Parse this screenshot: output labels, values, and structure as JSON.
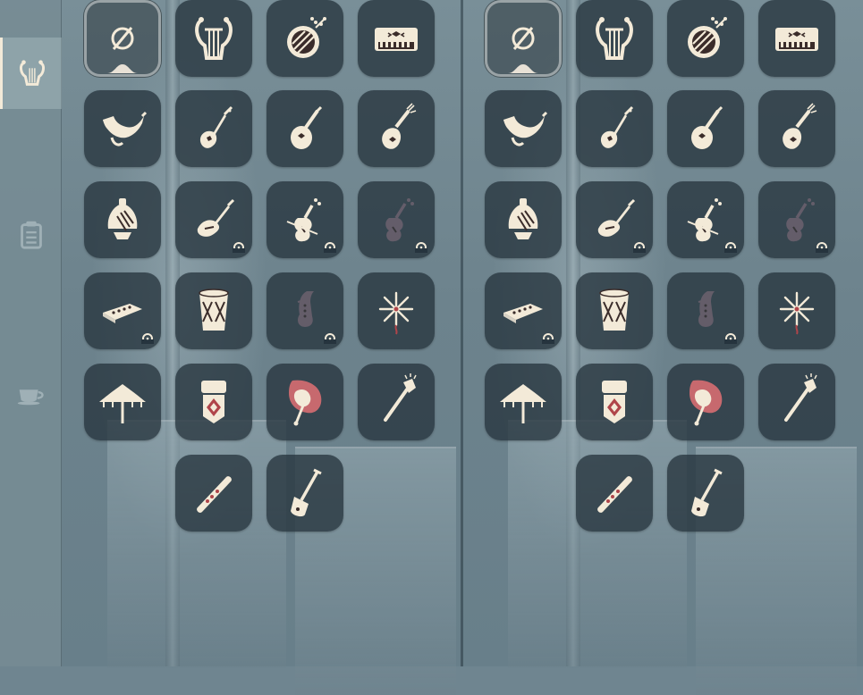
{
  "colors": {
    "icon_cream": "#f3ead8",
    "icon_dark": "#3a2c2a",
    "accent_red": "#b0454a",
    "slot_bg": "#26343e",
    "locked_icon": "#8a7080"
  },
  "sidebar": {
    "tabs": [
      {
        "icon": "lyre-icon",
        "active": true
      },
      {
        "icon": "clipboard-icon",
        "active": false
      },
      {
        "icon": "teacup-icon",
        "active": false
      }
    ]
  },
  "panels": [
    {
      "name": "left",
      "slots": [
        {
          "icon": "none-icon",
          "selected": true,
          "locked": false,
          "badge": false
        },
        {
          "icon": "lyre-icon",
          "selected": false,
          "locked": false,
          "badge": false
        },
        {
          "icon": "drum-icon",
          "selected": false,
          "locked": false,
          "badge": false
        },
        {
          "icon": "piano-icon",
          "selected": false,
          "locked": false,
          "badge": false
        },
        {
          "icon": "horn-icon",
          "selected": false,
          "locked": false,
          "badge": false
        },
        {
          "icon": "guitar-icon",
          "selected": false,
          "locked": false,
          "badge": false
        },
        {
          "icon": "mandolin-icon",
          "selected": false,
          "locked": false,
          "badge": false
        },
        {
          "icon": "pipa-icon",
          "selected": false,
          "locked": false,
          "badge": false
        },
        {
          "icon": "bell-icon",
          "selected": false,
          "locked": false,
          "badge": false
        },
        {
          "icon": "electric-guitar-icon",
          "selected": false,
          "locked": false,
          "badge": true
        },
        {
          "icon": "violin-icon",
          "selected": false,
          "locked": false,
          "badge": true
        },
        {
          "icon": "cello-icon",
          "selected": false,
          "locked": true,
          "badge": true
        },
        {
          "icon": "harmonica-icon",
          "selected": false,
          "locked": false,
          "badge": true
        },
        {
          "icon": "tall-drum-icon",
          "selected": false,
          "locked": false,
          "badge": false
        },
        {
          "icon": "saxophone-icon",
          "selected": false,
          "locked": true,
          "badge": true
        },
        {
          "icon": "firework-icon",
          "selected": false,
          "locked": false,
          "badge": false
        },
        {
          "icon": "umbrella-icon",
          "selected": false,
          "locked": false,
          "badge": false
        },
        {
          "icon": "lantern-icon",
          "selected": false,
          "locked": false,
          "badge": false
        },
        {
          "icon": "hand-fan-icon",
          "selected": false,
          "locked": false,
          "badge": false
        },
        {
          "icon": "brush-icon",
          "selected": false,
          "locked": false,
          "badge": false
        },
        {
          "icon": "flute-icon",
          "selected": false,
          "locked": false,
          "badge": false
        },
        {
          "icon": "shovel-icon",
          "selected": false,
          "locked": false,
          "badge": false
        }
      ]
    },
    {
      "name": "right",
      "slots": [
        {
          "icon": "none-icon",
          "selected": true,
          "locked": false,
          "badge": false
        },
        {
          "icon": "lyre-icon",
          "selected": false,
          "locked": false,
          "badge": false
        },
        {
          "icon": "drum-icon",
          "selected": false,
          "locked": false,
          "badge": false
        },
        {
          "icon": "piano-icon",
          "selected": false,
          "locked": false,
          "badge": false
        },
        {
          "icon": "horn-icon",
          "selected": false,
          "locked": false,
          "badge": false
        },
        {
          "icon": "guitar-icon",
          "selected": false,
          "locked": false,
          "badge": false
        },
        {
          "icon": "mandolin-icon",
          "selected": false,
          "locked": false,
          "badge": false
        },
        {
          "icon": "pipa-icon",
          "selected": false,
          "locked": false,
          "badge": false
        },
        {
          "icon": "bell-icon",
          "selected": false,
          "locked": false,
          "badge": false
        },
        {
          "icon": "electric-guitar-icon",
          "selected": false,
          "locked": false,
          "badge": true
        },
        {
          "icon": "violin-icon",
          "selected": false,
          "locked": false,
          "badge": true
        },
        {
          "icon": "cello-icon",
          "selected": false,
          "locked": true,
          "badge": true
        },
        {
          "icon": "harmonica-icon",
          "selected": false,
          "locked": false,
          "badge": true
        },
        {
          "icon": "tall-drum-icon",
          "selected": false,
          "locked": false,
          "badge": false
        },
        {
          "icon": "saxophone-icon",
          "selected": false,
          "locked": true,
          "badge": true
        },
        {
          "icon": "firework-icon",
          "selected": false,
          "locked": false,
          "badge": false
        },
        {
          "icon": "umbrella-icon",
          "selected": false,
          "locked": false,
          "badge": false
        },
        {
          "icon": "lantern-icon",
          "selected": false,
          "locked": false,
          "badge": false
        },
        {
          "icon": "hand-fan-icon",
          "selected": false,
          "locked": false,
          "badge": false
        },
        {
          "icon": "brush-icon",
          "selected": false,
          "locked": false,
          "badge": false
        },
        {
          "icon": "flute-icon",
          "selected": false,
          "locked": false,
          "badge": false
        },
        {
          "icon": "shovel-icon",
          "selected": false,
          "locked": false,
          "badge": false
        }
      ]
    }
  ]
}
